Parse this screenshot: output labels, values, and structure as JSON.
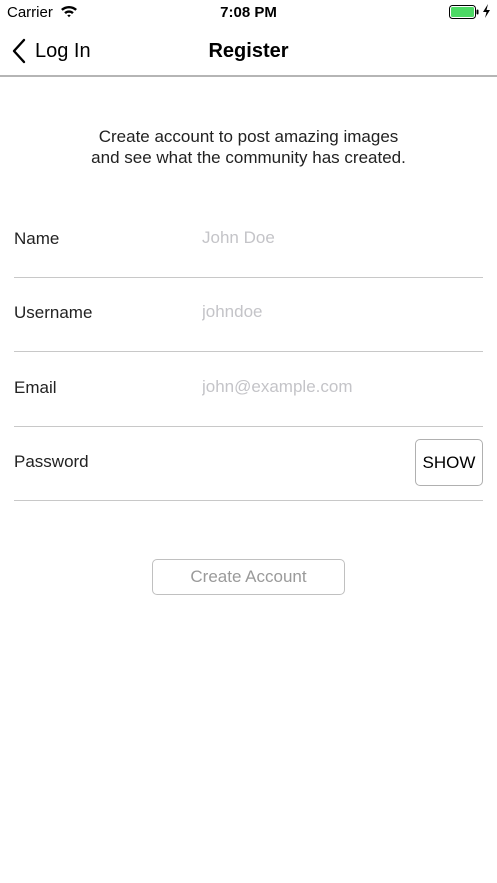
{
  "status_bar": {
    "carrier": "Carrier",
    "time": "7:08 PM",
    "battery_color": "#4cd964"
  },
  "nav": {
    "back_label": "Log In",
    "title": "Register"
  },
  "intro_text": "Create account to post amazing images and see what the community has created.",
  "fields": {
    "name": {
      "label": "Name",
      "placeholder": "John Doe",
      "value": ""
    },
    "username": {
      "label": "Username",
      "placeholder": "johndoe",
      "value": ""
    },
    "email": {
      "label": "Email",
      "placeholder": "john@example.com",
      "value": ""
    },
    "password": {
      "label": "Password",
      "placeholder": "",
      "value": "",
      "show_label": "SHOW"
    }
  },
  "create_button_label": "Create Account"
}
